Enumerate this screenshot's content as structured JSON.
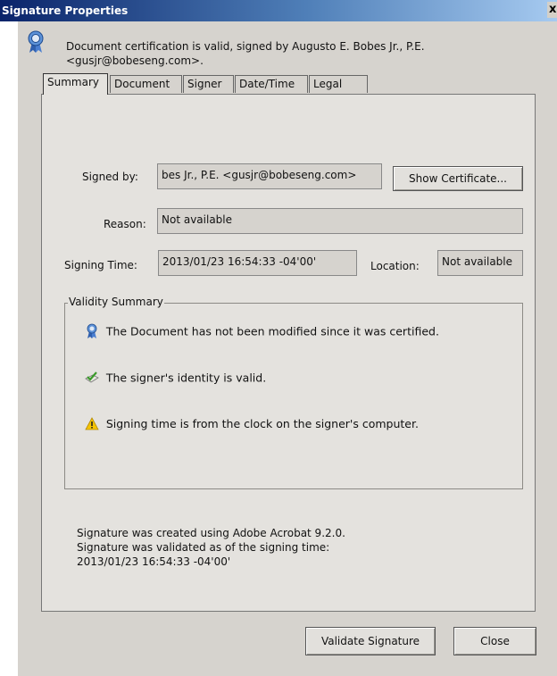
{
  "window": {
    "title": "Signature Properties",
    "close_label": "x"
  },
  "header": {
    "message": "Document certification is valid, signed by Augusto E. Bobes Jr., P.E. <gusjr@bobeseng.com>."
  },
  "tabs": [
    {
      "label": "Summary",
      "active": true
    },
    {
      "label": "Document",
      "active": false
    },
    {
      "label": "Signer",
      "active": false
    },
    {
      "label": "Date/Time",
      "active": false
    },
    {
      "label": "Legal",
      "active": false
    }
  ],
  "summary": {
    "signed_by_label": "Signed by:",
    "signed_by_value": "bes Jr., P.E. <gusjr@bobeseng.com>",
    "show_certificate_label": "Show Certificate...",
    "reason_label": "Reason:",
    "reason_value": "Not available",
    "signing_time_label": "Signing Time:",
    "signing_time_value": "2013/01/23 16:54:33 -04'00'",
    "location_label": "Location:",
    "location_value": "Not available"
  },
  "validity": {
    "title": "Validity Summary",
    "items": [
      {
        "icon": "certified-ribbon-icon",
        "text": "The Document has not been modified since it was certified."
      },
      {
        "icon": "signer-valid-check-icon",
        "text": "The signer's identity is valid."
      },
      {
        "icon": "warning-triangle-icon",
        "text": "Signing time is from the clock on the signer's computer."
      }
    ]
  },
  "footer": {
    "line1": "Signature was created using Adobe Acrobat 9.2.0.",
    "line2": "Signature was validated as of the signing time:",
    "line3": "2013/01/23 16:54:33 -04'00'"
  },
  "buttons": {
    "validate_label": "Validate Signature",
    "close_label": "Close"
  },
  "colors": {
    "title_bar": "#0a246a",
    "dialog_bg": "#d6d3ce",
    "warning": "#f5c400",
    "ribbon": "#3a6fc4",
    "check": "#3a9a2a"
  }
}
